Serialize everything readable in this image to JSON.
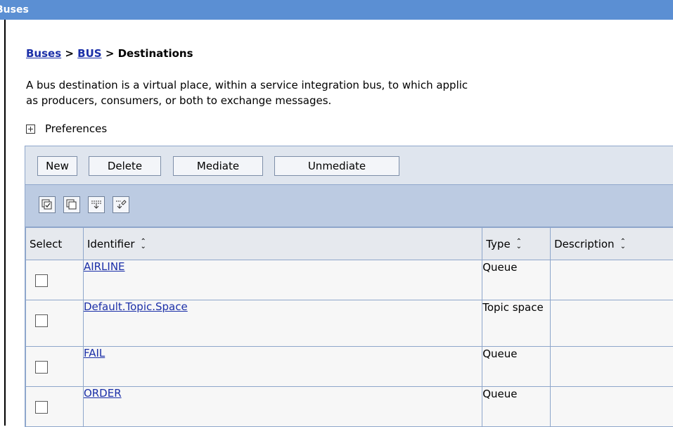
{
  "window": {
    "title": "Buses"
  },
  "breadcrumb": {
    "link1": "Buses",
    "sep1": " > ",
    "link2": "BUS",
    "sep2": " > ",
    "current": "Destinations"
  },
  "description": {
    "line1": "A bus destination is a virtual place, within a service integration bus, to which applic",
    "line2": "as producers, consumers, or both to exchange messages."
  },
  "preferences": {
    "label": "Preferences",
    "icon": "plus-box-icon"
  },
  "toolbar": {
    "new": "New",
    "delete": "Delete",
    "mediate": "Mediate",
    "unmediate": "Unmediate"
  },
  "icon_toolbar": [
    "select-all-icon",
    "deselect-all-icon",
    "show-filter-icon",
    "clear-filter-icon"
  ],
  "table": {
    "headers": {
      "select": "Select",
      "identifier": "Identifier",
      "type": "Type",
      "description": "Description"
    },
    "rows": [
      {
        "identifier": "AIRLINE",
        "type": "Queue",
        "description": ""
      },
      {
        "identifier": "Default.Topic.Space",
        "type": "Topic space",
        "description": ""
      },
      {
        "identifier": "FAIL",
        "type": "Queue",
        "description": ""
      },
      {
        "identifier": "ORDER",
        "type": "Queue",
        "description": ""
      }
    ]
  },
  "colors": {
    "titlebar": "#5b8fd3",
    "link": "#1b2fa8",
    "toolbar_top": "#dfe5ee",
    "toolbar_icons": "#bccbe2"
  }
}
